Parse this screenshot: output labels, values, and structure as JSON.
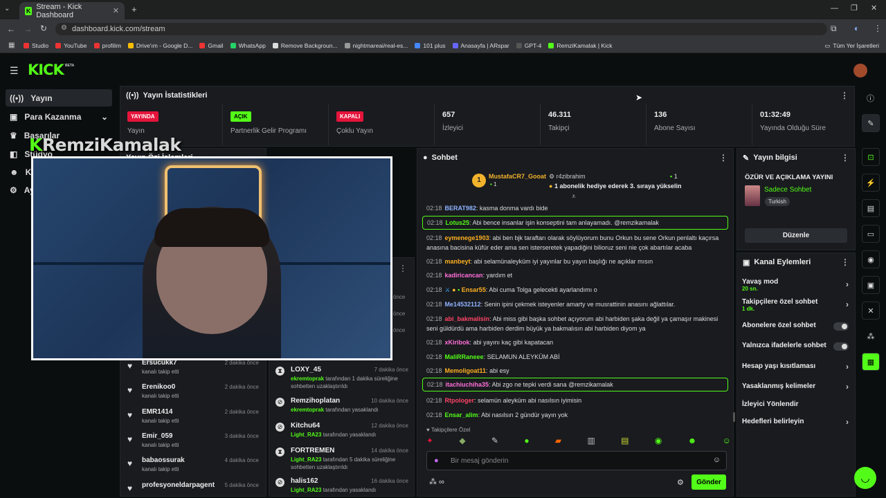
{
  "browser": {
    "tab_title": "Stream - Kick Dashboard",
    "url": "dashboard.kick.com/stream",
    "bookmarks": [
      "Studio",
      "YouTube",
      "profilim",
      "Drive'ım - Google D...",
      "Gmail",
      "WhatsApp",
      "Remove Backgroun...",
      "nightmareai/real-es...",
      "101 plus",
      "Anasayfa | ARspar",
      "GPT-4",
      "RemziKamalak | Kick"
    ],
    "all_bookmarks": "Tüm Yer İşaretleri"
  },
  "brand": {
    "logo": "KICK",
    "beta": "BETA",
    "overlay_name": "RemziKamalak"
  },
  "sidebar": {
    "items": [
      "Yayın",
      "Para Kazanma",
      "Başarılar",
      "Stüdyo",
      "Kanal",
      "Ayarlar"
    ]
  },
  "stats": {
    "title": "Yayın İstatistikleri",
    "items": [
      {
        "badge": "YAYINDA",
        "label": "Yayın"
      },
      {
        "badge": "AÇIK",
        "label": "Partnerlik Gelir Programı"
      },
      {
        "badge": "KAPALI",
        "label": "Çoklu Yayın"
      },
      {
        "value": "657",
        "label": "İzleyici"
      },
      {
        "value": "46.311",
        "label": "Takipçi"
      },
      {
        "value": "136",
        "label": "Abone Sayısı"
      },
      {
        "value": "01:32:49",
        "label": "Yayında Olduğu Süre"
      }
    ],
    "colors": {
      "live": "#e5143b",
      "on": "#53fc18",
      "off": "#e5143b"
    }
  },
  "feed_header": "Yayın Özi İşlemleri",
  "followers": [
    {
      "name": "Ersucukk7",
      "sub": "kanalı takip etti",
      "time": "2 dakika önce"
    },
    {
      "name": "Erenikoo0",
      "sub": "kanalı takip etti",
      "time": "2 dakika önce"
    },
    {
      "name": "EMR1414",
      "sub": "kanalı takip etti",
      "time": "2 dakika önce"
    },
    {
      "name": "Emir_059",
      "sub": "kanalı takip etti",
      "time": "3 dakika önce"
    },
    {
      "name": "babaossurak",
      "sub": "kanalı takip etti",
      "time": "4 dakika önce"
    },
    {
      "name": "profesyoneldarpagent",
      "sub": "",
      "time": "5 dakika önce"
    }
  ],
  "modlog": [
    {
      "name": "LOXY_45",
      "mod": "ekremtoprak",
      "sub": "tarafından 1 dakika süreliğine sohbetten uzaklaştırıldı",
      "time": "7 dakika önce",
      "icon": "timeout"
    },
    {
      "name": "Remzihoplatan",
      "mod": "ekremtoprak",
      "sub": "tarafından yasaklandı",
      "time": "10 dakika önce",
      "icon": "ban"
    },
    {
      "name": "Kitchu64",
      "mod": "Light_RA23",
      "sub": "tarafından yasaklandı",
      "time": "12 dakika önce",
      "icon": "ban"
    },
    {
      "name": "FORTREMEN",
      "mod": "Light_RA23",
      "sub": "tarafından 5 dakika süreliğine sohbetten uzaklaştırıldı",
      "time": "14 dakika önce",
      "icon": "timeout"
    },
    {
      "name": "halis162",
      "mod": "Light_RA23",
      "sub": "tarafından yasaklandı",
      "time": "16 dakika önce",
      "icon": "ban"
    }
  ],
  "modlog_partial_times": [
    "önce",
    "önce",
    "önce"
  ],
  "chat": {
    "title": "Sohbet",
    "pinned": {
      "user1": "MustafaCR7_Gooat",
      "count1": "1",
      "user2": "r4zibrahim",
      "count2": "1",
      "text": "1 abonelik hediye ederek 3. sıraya yükselin",
      "rank": "1"
    },
    "messages": [
      {
        "time": "02:18",
        "user": "BERAT982",
        "color": "#8fb3ff",
        "text": "kasma donma vardı bide"
      },
      {
        "time": "02:18",
        "user": "Lotus25",
        "color": "#53fc18",
        "text": "Abi bence insanlar işin konseptini tam anlayamadı. @remzikamalak",
        "hl": true
      },
      {
        "time": "02:18",
        "user": "eymenege1903",
        "color": "#ffb020",
        "text": "abi ben bjk taraftarı olarak söylüyorum bunu Orkun bu sene Orkun penlaltı kaçırsa anasına bacisina küfür eder ama sen isterseretek yapadiğini bilioruz seni nie çok abartılar acaba"
      },
      {
        "time": "02:18",
        "user": "manbeyt",
        "color": "#ffb020",
        "text": "abi selamünaleyküm iyi yayınlar bu yayın başlığı ne açıklar mısın"
      },
      {
        "time": "02:18",
        "user": "kadiricancan",
        "color": "#ff6fd8",
        "text": "yardım et"
      },
      {
        "time": "02:18",
        "user": "Ensar55",
        "color": "#ffb020",
        "text": "Abi cuma Tolga gelecekti ayarlandımı o",
        "badges": true
      },
      {
        "time": "02:18",
        "user": "Me14532112",
        "color": "#8fb3ff",
        "text": "Senin ipini çekmek isteyenler amarty ve musrattinin anasını ağlattılar."
      },
      {
        "time": "02:18",
        "user": "abi_bakmalisin",
        "color": "#ff4466",
        "text": "Abi miss gibi başka sohbet açıyorum abi harbiden şaka değil ya çamaşır makinesi seni güldürdü ama harbiden derdim büyük ya bakmalısın abi harbiden diyom ya"
      },
      {
        "time": "02:18",
        "user": "xKiribok",
        "color": "#ff6fd8",
        "text": "abi yayını kaç gibi kapatacan"
      },
      {
        "time": "02:18",
        "user": "MaliRRaneee",
        "color": "#53fc18",
        "text": "SELAMUN ALEYKÜM ABİ"
      },
      {
        "time": "02:18",
        "user": "Memoligoat11",
        "color": "#ffb020",
        "text": "abi esy"
      },
      {
        "time": "02:18",
        "user": "itachiuchiha35",
        "color": "#ff6fd8",
        "text": "Abi zgo ne tepki verdi sana @remzikamalak",
        "hl": true
      },
      {
        "time": "02:18",
        "user": "Rtpologer",
        "color": "#ff4466",
        "text": "selamün aleyküm abi nasılsın iyimisin"
      },
      {
        "time": "02:18",
        "user": "Ensar_alim",
        "color": "#53fc18",
        "text": "Abi nasılsın 2 gündür yayın yok"
      }
    ],
    "follower_only_label": "Takipçilere Özel",
    "input_placeholder": "Bir mesaj gönderin",
    "send_label": "Gönder"
  },
  "stream_info": {
    "title": "Yayın bilgisi",
    "stream_title": "ÖZÜR VE AÇIKLAMA YAYINI",
    "category": "Sadece Sohbet",
    "language": "Turkish",
    "edit_label": "Düzenle"
  },
  "channel_actions": {
    "title": "Kanal Eylemleri",
    "items": [
      {
        "label": "Yavaş mod",
        "sub": "20 sn.",
        "kind": "chevron"
      },
      {
        "label": "Takipçilere özel sohbet",
        "sub": "1 dk.",
        "kind": "chevron"
      },
      {
        "label": "Abonelere özel sohbet",
        "kind": "toggle"
      },
      {
        "label": "Yalnızca ifadelerle sohbet",
        "kind": "toggle"
      },
      {
        "label": "Hesap yaşı kısıtlaması",
        "kind": "chevron"
      },
      {
        "label": "Yasaklanmış kelimeler",
        "kind": "chevron"
      },
      {
        "label": "İzleyici Yönlendir",
        "kind": "none"
      },
      {
        "label": "Hedefleri belirleyin",
        "kind": "chevron"
      }
    ]
  },
  "accent": "#53fc18"
}
